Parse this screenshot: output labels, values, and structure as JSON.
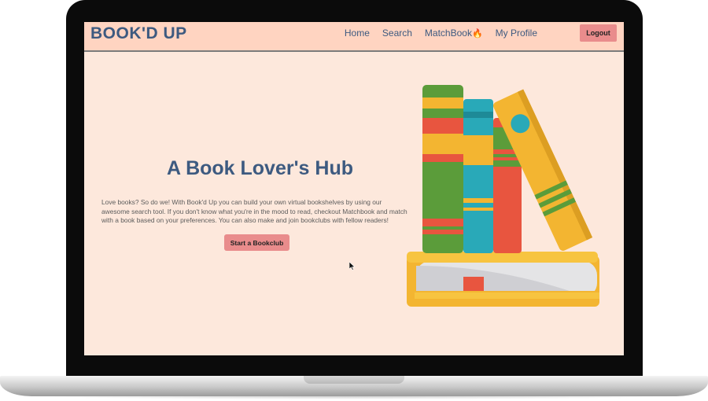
{
  "nav": {
    "logo": "BOOK'D UP",
    "links": [
      "Home",
      "Search",
      "MatchBook",
      "My Profile"
    ],
    "matchbook_icon": "flame-icon",
    "logout": "Logout"
  },
  "hero": {
    "title": "A Book Lover's Hub",
    "description": "Love books? So do we! With Book'd Up you can build your own virtual bookshelves by using our awesome search tool. If you don't know what you're in the mood to read, checkout Matchbook and match with a book based on your preferences. You can also make and join bookclubs with fellow readers!",
    "cta": "Start a Bookclub"
  },
  "colors": {
    "page_background": "#fde8dc",
    "navbar_background": "#ffd4c1",
    "brand_text": "#3d5a80",
    "button": "#e98c8c"
  }
}
